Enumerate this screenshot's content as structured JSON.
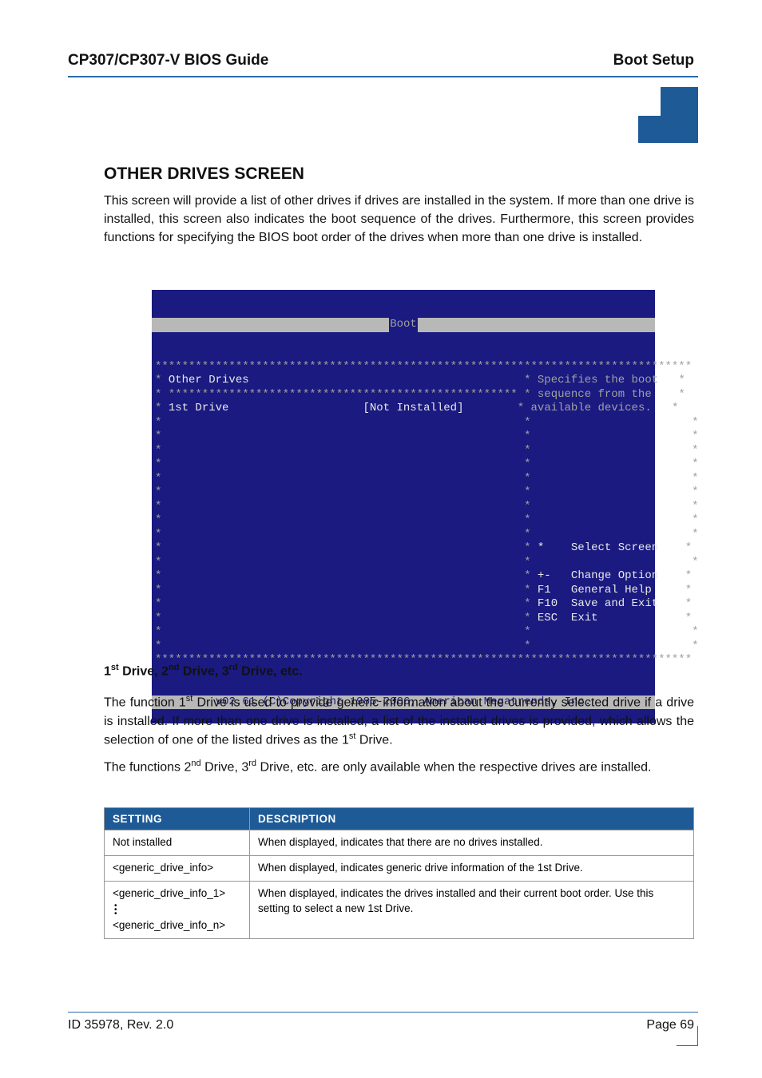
{
  "header": {
    "left": "CP307/CP307-V BIOS Guide",
    "right": "Boot Setup"
  },
  "section_title": "OTHER DRIVES SCREEN",
  "body_text": "This screen will provide a list of other drives if drives are installed in the system. If more than one drive is installed, this screen also indicates the boot sequence of the drives. Furthermore, this screen provides functions for specifying the BIOS boot order of the drives when more than one drive is installed.",
  "bios": {
    "title": "Boot",
    "panel_title": "Other Drives",
    "field_label": "1st Drive",
    "field_value": "[Not Installed]",
    "help_line1": "Specifies the boot",
    "help_line2": "sequence from the",
    "help_line3": "available devices.",
    "nav_select": "Select Screen",
    "nav_change": "Change Option",
    "nav_help": "General Help",
    "nav_save": "Save and Exit",
    "nav_exit": "Exit",
    "key_arrow": "*",
    "key_pm": "+-",
    "key_f1": "F1",
    "key_f10": "F10",
    "key_esc": "ESC",
    "copyright": "v02.61 (C)Copyright 1985-2006, American Megatrends, Inc."
  },
  "subtitle_parts": {
    "p1": "1",
    "s1": "st",
    "p2": " Drive, 2",
    "s2": "nd",
    "p3": " Drive, 3",
    "s3": "rd",
    "p4": " Drive, etc."
  },
  "body2": {
    "p1": "The function 1",
    "s1": "st",
    "p2": " Drive is used to provide generic information about the currently selected drive if a drive is installed. If more than one drive is installed, a list of the installed drives is provided, which allows the selection of one of the listed drives as the 1",
    "s2": "st",
    "p3": " Drive."
  },
  "body3": {
    "p1": "The functions 2",
    "s1": "nd",
    "p2": " Drive, 3",
    "s2": "rd",
    "p3": " Drive, etc. are only available when the respective drives are installed."
  },
  "table": {
    "h1": "SETTING",
    "h2": "DESCRIPTION",
    "r1c1": "Not installed",
    "r1c2": "When displayed, indicates that there are no drives installed.",
    "r2c1": "<generic_drive_info>",
    "r2c2": "When displayed, indicates generic drive information of the 1st Drive.",
    "r3c1a": "<generic_drive_info_1>",
    "r3c1b": "<generic_drive_info_n>",
    "r3c2": "When displayed, indicates the drives installed and their current boot order. Use this setting to select a new 1st Drive."
  },
  "footer": {
    "left": "ID 35978, Rev. 2.0",
    "right": "Page 69"
  }
}
